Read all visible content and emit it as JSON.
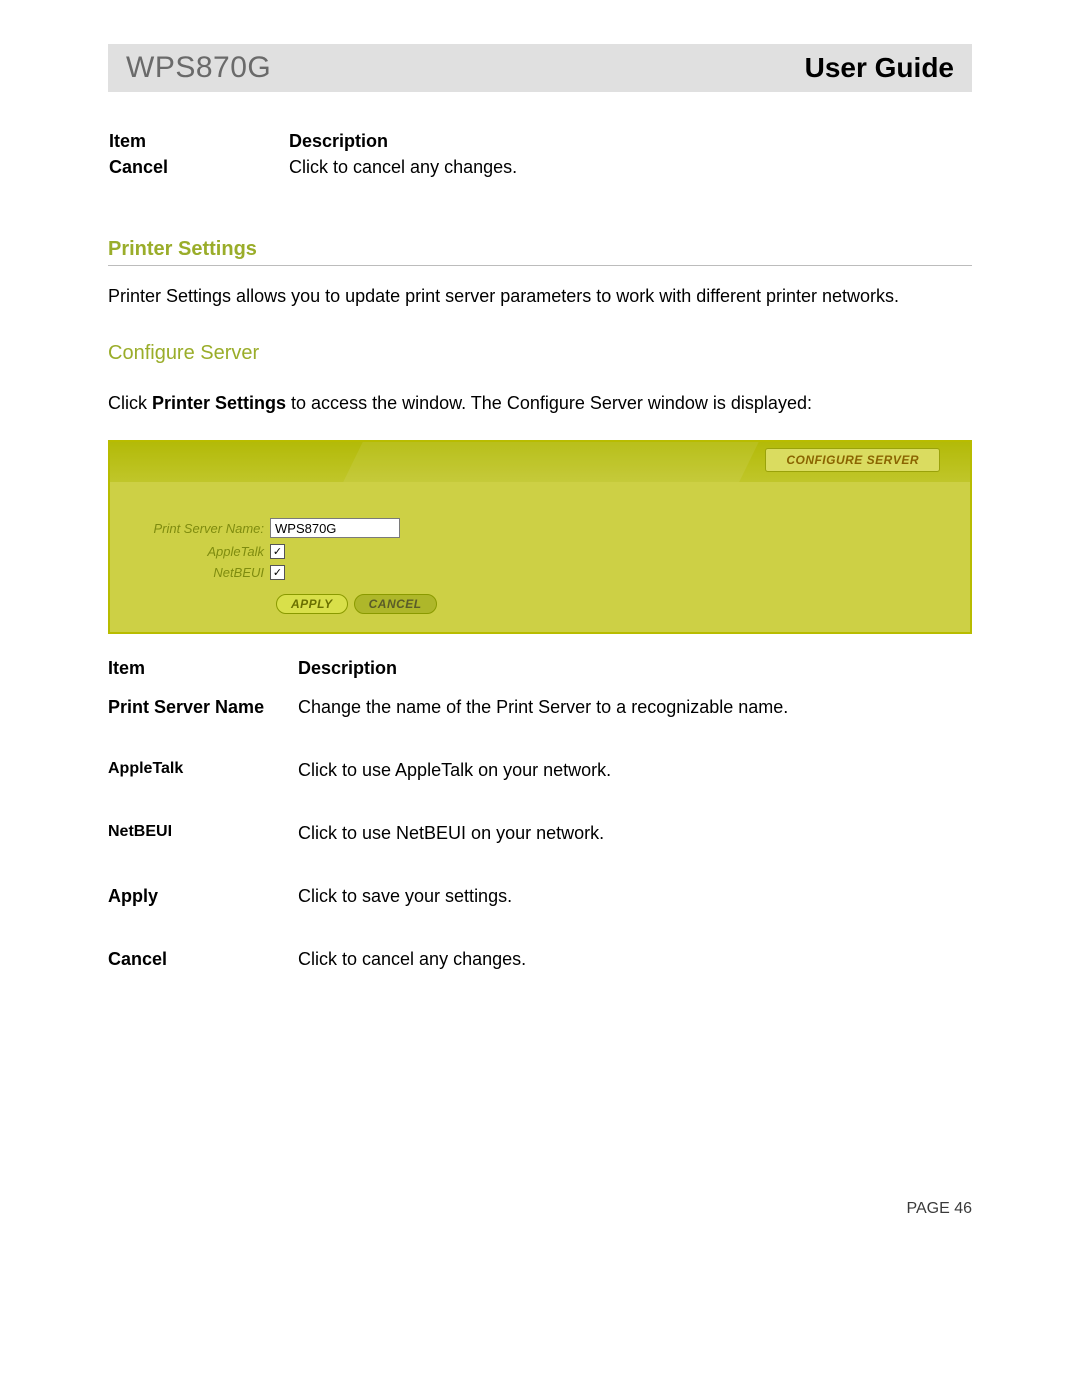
{
  "header": {
    "model": "WPS870G",
    "doc": "User Guide"
  },
  "top_table": {
    "headers": {
      "item": "Item",
      "desc": "Description"
    },
    "rows": [
      {
        "item": "Cancel",
        "desc": "Click to cancel any changes."
      }
    ]
  },
  "section": {
    "title": "Printer Settings",
    "para": "Printer Settings allows you to update print server parameters to work with different printer networks.",
    "subtitle": "Configure Server",
    "instr_pre": "Click ",
    "instr_bold": "Printer Settings",
    "instr_post": " to access the window. The Configure Server window is displayed:"
  },
  "ui": {
    "tab": "CONFIGURE SERVER",
    "labels": {
      "psn": "Print Server Name:",
      "apple": "AppleTalk",
      "netbeui": "NetBEUI"
    },
    "values": {
      "psn": "WPS870G",
      "apple_checked": "✓",
      "netbeui_checked": "✓"
    },
    "buttons": {
      "apply": "APPLY",
      "cancel": "CANCEL"
    }
  },
  "desc_table": {
    "headers": {
      "item": "Item",
      "desc": "Description"
    },
    "rows": [
      {
        "item": "Print Server Name",
        "desc": "Change the name of the Print Server to a recognizable name.",
        "small": false
      },
      {
        "item": "AppleTalk",
        "desc": "Click to use AppleTalk on your network.",
        "small": true
      },
      {
        "item": "NetBEUI",
        "desc": "Click to use NetBEUI on your network.",
        "small": true
      },
      {
        "item": "Apply",
        "desc": "Click to save your settings.",
        "small": false
      },
      {
        "item": "Cancel",
        "desc": "Click to cancel any changes.",
        "small": false
      }
    ]
  },
  "footer": {
    "page": "PAGE 46"
  }
}
